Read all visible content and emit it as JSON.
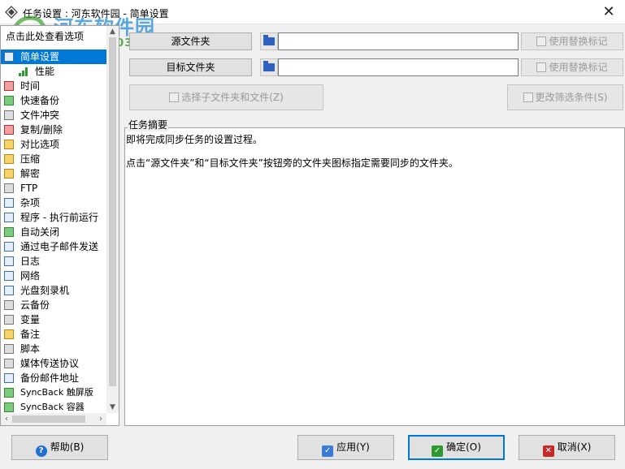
{
  "window": {
    "title": "任务设置 : 河东软件园 - 简单设置",
    "close_glyph": "✕"
  },
  "watermark": {
    "text": "河东软件园",
    "url": "www.pc0359.cn"
  },
  "sidebar": {
    "header": "点击此处查看选项",
    "items": [
      {
        "label": "简单设置",
        "icon": "checkbox-icon",
        "selected": true
      },
      {
        "label": "性能",
        "icon": "bar-chart-icon",
        "sub": true
      },
      {
        "label": "时间",
        "icon": "clock-icon"
      },
      {
        "label": "快速备份",
        "icon": "arrow-icon"
      },
      {
        "label": "文件冲突",
        "icon": "conflict-icon"
      },
      {
        "label": "复制/删除",
        "icon": "copy-icon"
      },
      {
        "label": "对比选项",
        "icon": "compare-icon"
      },
      {
        "label": "压缩",
        "icon": "archive-icon"
      },
      {
        "label": "解密",
        "icon": "lock-icon"
      },
      {
        "label": "FTP",
        "icon": "ftp-icon"
      },
      {
        "label": "杂项",
        "icon": "misc-icon"
      },
      {
        "label": "程序 - 执行前运行",
        "icon": "program-icon"
      },
      {
        "label": "自动关闭",
        "icon": "shutdown-icon"
      },
      {
        "label": "通过电子邮件发送",
        "icon": "email-icon"
      },
      {
        "label": "日志",
        "icon": "log-icon"
      },
      {
        "label": "网络",
        "icon": "network-icon"
      },
      {
        "label": "光盘刻录机",
        "icon": "disc-icon"
      },
      {
        "label": "云备份",
        "icon": "cloud-icon"
      },
      {
        "label": "变量",
        "icon": "variable-icon"
      },
      {
        "label": "备注",
        "icon": "note-icon"
      },
      {
        "label": "脚本",
        "icon": "script-icon"
      },
      {
        "label": "媒体传送协议",
        "icon": "media-icon"
      },
      {
        "label": "备份邮件地址",
        "icon": "mail-address-icon"
      },
      {
        "label": "SyncBack 触屏版",
        "icon": "touch-icon"
      },
      {
        "label": "SyncBack 容器",
        "icon": "container-icon"
      }
    ]
  },
  "source": {
    "button_label": "源文件夹",
    "value": "",
    "replace_label": "使用替换标记"
  },
  "target": {
    "button_label": "目标文件夹",
    "value": "",
    "replace_label": "使用替换标记"
  },
  "actions": {
    "select_sub_label": "选择子文件夹和文件(Z)",
    "filter_label": "更改筛选条件(S)"
  },
  "summary": {
    "legend": "任务摘要",
    "line1": "即将完成同步任务的设置过程。",
    "line2": "点击“源文件夹”和“目标文件夹”按钮旁的文件夹图标指定需要同步的文件夹。"
  },
  "footer": {
    "help_label": "帮助(B)",
    "apply_label": "应用(Y)",
    "ok_label": "确定(O)",
    "cancel_label": "取消(X)"
  },
  "colors": {
    "selection": "#0078d7",
    "default_button_border": "#0078d7"
  }
}
